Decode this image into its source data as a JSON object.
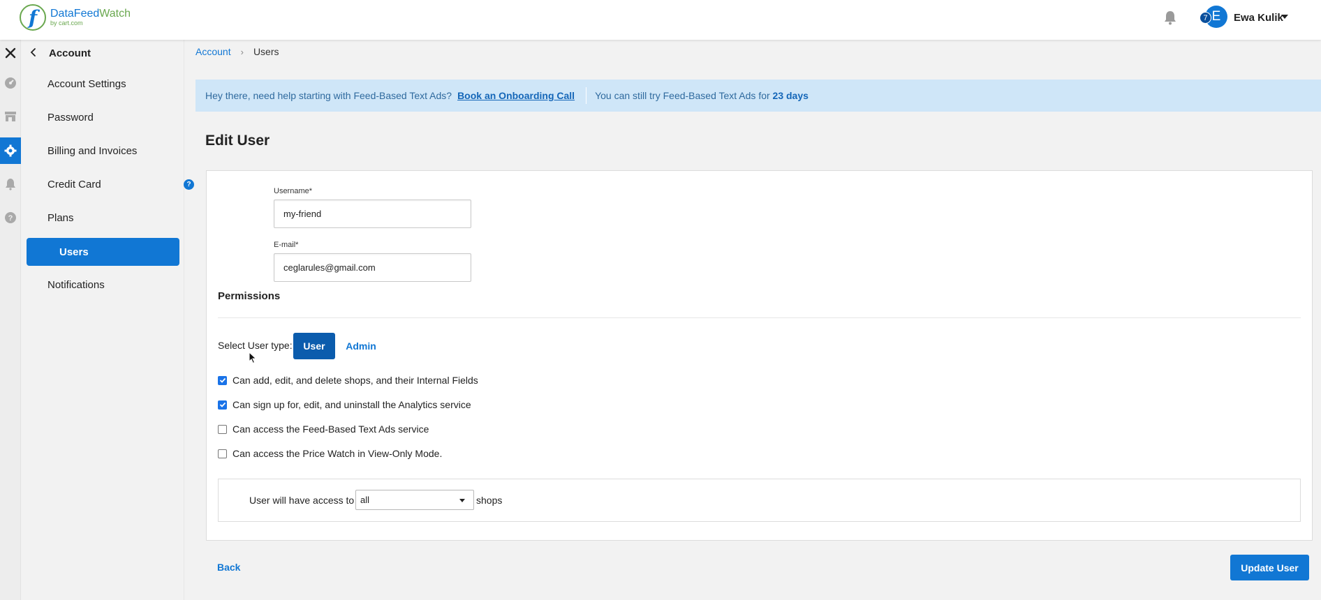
{
  "header": {
    "logo_name_a": "DataFeed",
    "logo_name_b": "Watch",
    "logo_sub": "by cart.com",
    "logo_letter": "f",
    "avatar_initial": "E",
    "avatar_badge": "7",
    "user_name": "Ewa Kulik"
  },
  "sidebar": {
    "title": "Account",
    "items": [
      {
        "label": "Account Settings"
      },
      {
        "label": "Password"
      },
      {
        "label": "Billing and Invoices"
      },
      {
        "label": "Credit Card",
        "badge": "?"
      },
      {
        "label": "Plans"
      },
      {
        "label": "Users"
      },
      {
        "label": "Notifications"
      }
    ]
  },
  "breadcrumb": {
    "root": "Account",
    "current": "Users"
  },
  "banner": {
    "text": "Hey there, need help starting with Feed-Based Text Ads?",
    "link": "Book an Onboarding Call",
    "trial_prefix": "You can still try Feed-Based Text Ads for",
    "trial_days": "23 days"
  },
  "page": {
    "title": "Edit User"
  },
  "form": {
    "username_label": "Username*",
    "username_value": "my-friend",
    "email_label": "E-mail*",
    "email_value": "ceglarules@gmail.com"
  },
  "permissions": {
    "title": "Permissions",
    "user_type_label": "Select User type:",
    "user_button": "User",
    "admin_button": "Admin",
    "checks": [
      {
        "label": "Can add, edit, and delete shops, and their Internal Fields",
        "checked": true
      },
      {
        "label": "Can sign up for, edit, and uninstall the Analytics service",
        "checked": true
      },
      {
        "label": "Can access the Feed-Based Text Ads service",
        "checked": false
      },
      {
        "label": "Can access the Price Watch in View-Only Mode.",
        "checked": false
      }
    ],
    "access_prefix": "User will have access to",
    "access_value": "all",
    "access_suffix": "shops"
  },
  "footer": {
    "back": "Back",
    "update": "Update User"
  },
  "colors": {
    "accent": "#1177d4",
    "banner_bg": "#cfe6f8"
  },
  "icons": {
    "close": "close-icon",
    "rail": [
      "dashboard-icon",
      "store-icon",
      "gear-icon",
      "bell-icon",
      "help-icon"
    ]
  }
}
